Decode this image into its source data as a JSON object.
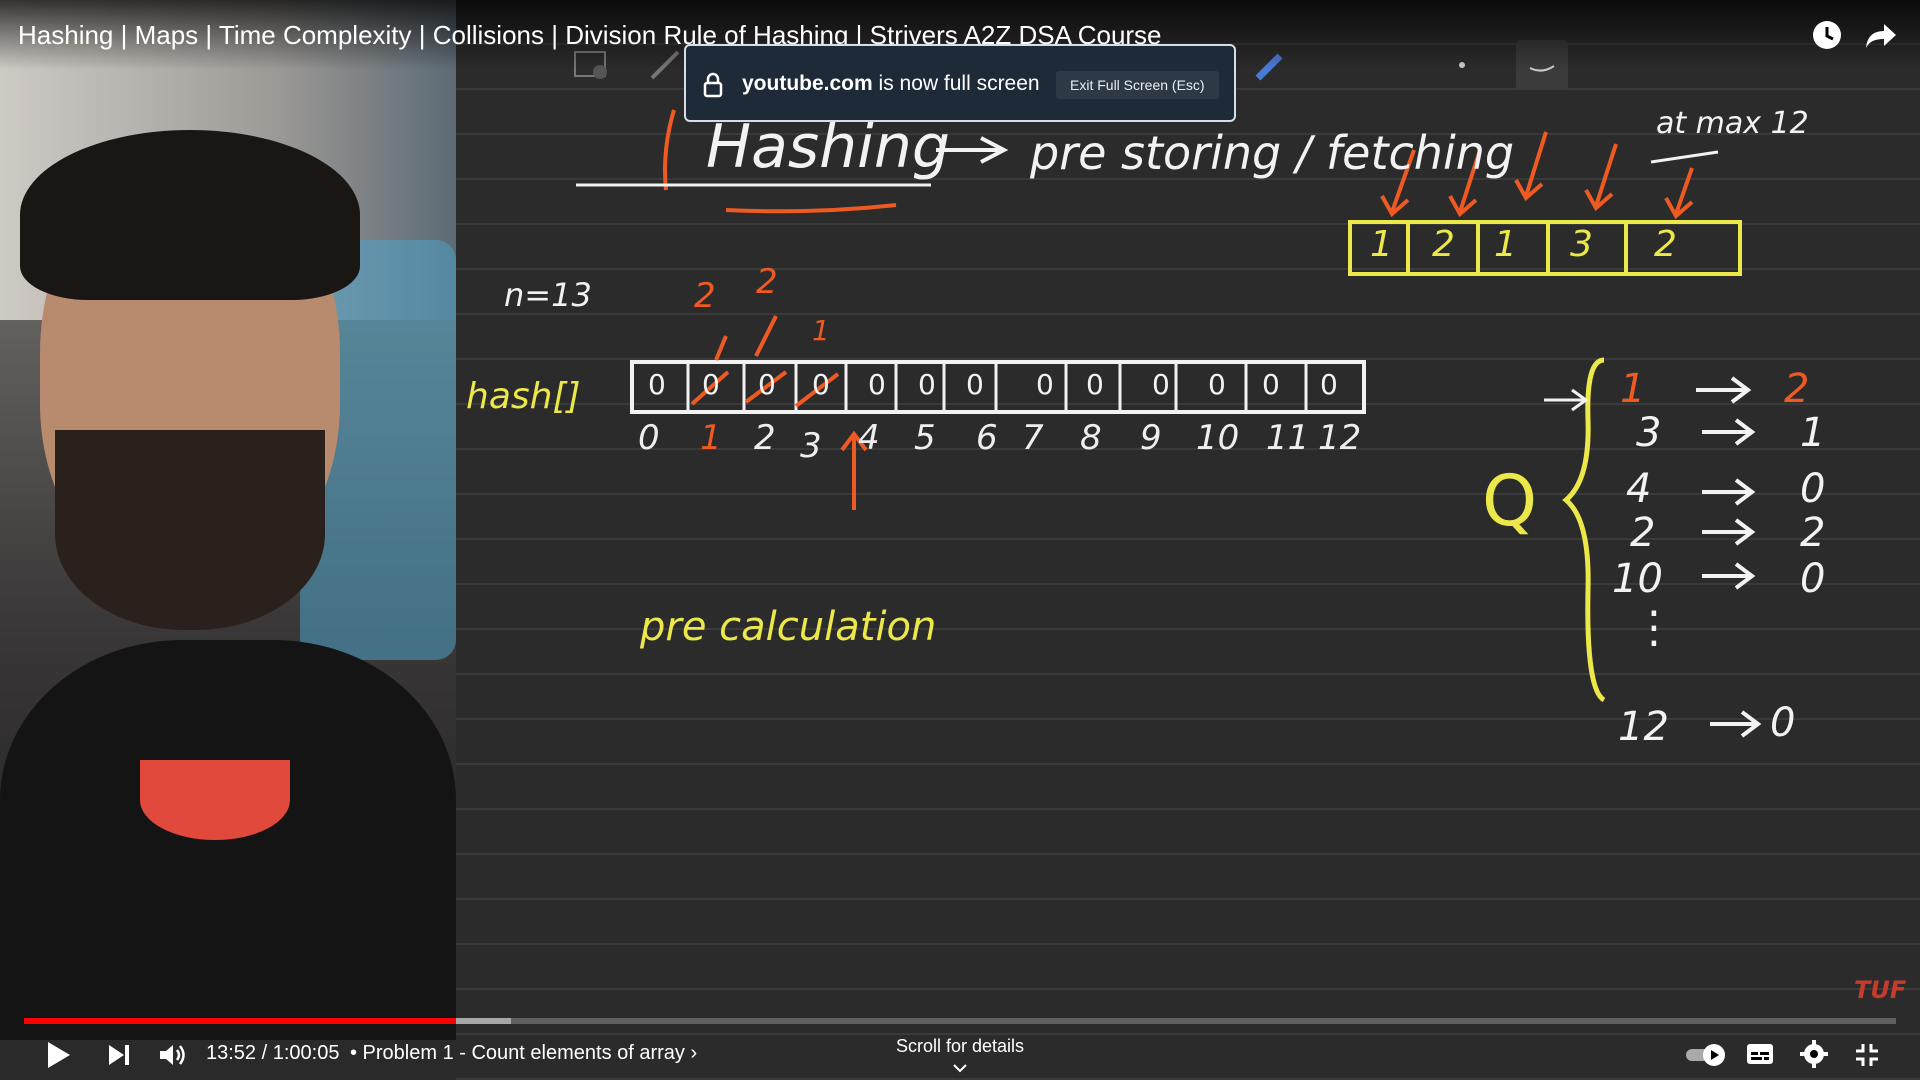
{
  "video": {
    "title": "Hashing | Maps | Time Complexity | Collisions | Division Rule of Hashing | Strivers A2Z DSA Course",
    "watermark": "TUF"
  },
  "fullscreen_toast": {
    "domain": "youtube.com",
    "message": "is now full screen",
    "exit_label": "Exit Full Screen (Esc)"
  },
  "board": {
    "heading": "Hashing",
    "heading_suffix": "pre storing / fetching",
    "n_label": "n=13",
    "array_name": "hash[]",
    "input_array": [
      "1",
      "2",
      "1",
      "3",
      "2"
    ],
    "query_label": "at max 12",
    "hash_values": [
      "0",
      "0",
      "0",
      "0",
      "0",
      "0",
      "0",
      "0",
      "0",
      "0",
      "0",
      "0",
      "0"
    ],
    "hash_indices": [
      "0",
      "1",
      "2",
      "3",
      "4",
      "5",
      "6",
      "7",
      "8",
      "9",
      "10",
      "11",
      "12"
    ],
    "overwrites": [
      "2",
      "2",
      "1"
    ],
    "pre_calc": "pre calculation",
    "q_label": "Q",
    "mapping": [
      {
        "key": "1",
        "value": "2"
      },
      {
        "key": "3",
        "value": "1"
      },
      {
        "key": "4",
        "value": "0"
      },
      {
        "key": "2",
        "value": "2"
      },
      {
        "key": "10",
        "value": "0"
      },
      {
        "key": "12",
        "value": "0"
      }
    ],
    "dots": "⋮"
  },
  "player": {
    "time": "13:52 / 1:00:05",
    "chapter": "• Problem 1 - Count elements of array",
    "chapter_arrow": "›",
    "scroll_hint": "Scroll for details",
    "progress_played": 0.231,
    "progress_buffered": 0.26
  },
  "colors": {
    "accent_red": "#ff0000",
    "ink_yellow": "#ede84a",
    "ink_orange": "#ef5a22",
    "board_bg": "#2b2b2c"
  },
  "icons": [
    "clock-icon",
    "share-icon",
    "lock-icon",
    "play-icon",
    "next-icon",
    "volume-icon",
    "autoplay-toggle-icon",
    "subtitles-icon",
    "settings-icon",
    "exit-fullscreen-icon"
  ]
}
